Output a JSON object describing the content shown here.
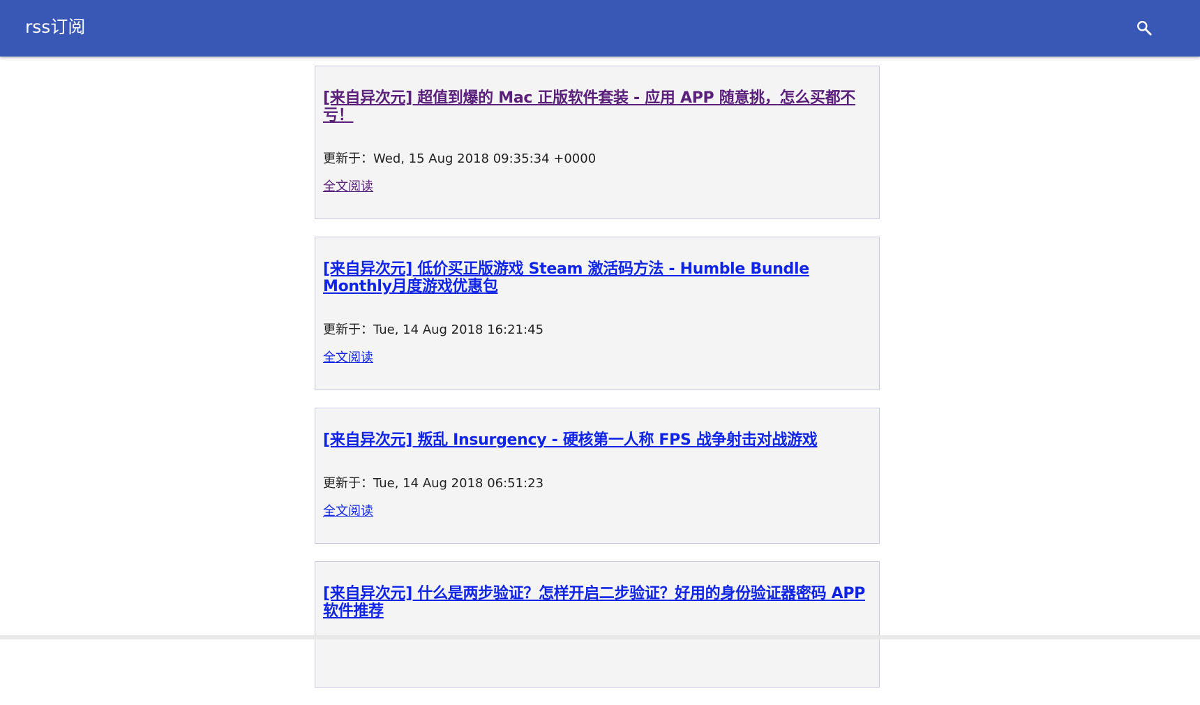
{
  "app": {
    "title": "rss订阅",
    "accent": "#3957b5",
    "search_icon": "search-icon"
  },
  "colors": {
    "visited_link": "#5a1f7a",
    "unvisited_link": "#0f24e6",
    "card_bg": "#f4f4f4",
    "card_border": "#c9cbe4"
  },
  "articles": [
    {
      "title": "[来自异次元] 超值到爆的 Mac 正版软件套装 - 应用 APP 随意挑，怎么买都不亏！",
      "updated_label": "更新于：Wed, 15 Aug 2018 09:35:34 +0000",
      "read_more": "全文阅读",
      "visited": true
    },
    {
      "title": "[来自异次元] 低价买正版游戏 Steam 激活码方法 - Humble Bundle Monthly月度游戏优惠包",
      "updated_label": "更新于：Tue, 14 Aug 2018 16:21:45",
      "read_more": "全文阅读",
      "visited": false
    },
    {
      "title": "[来自异次元] 叛乱 Insurgency - 硬核第一人称 FPS 战争射击对战游戏",
      "updated_label": "更新于：Tue, 14 Aug 2018 06:51:23",
      "read_more": "全文阅读",
      "visited": false
    },
    {
      "title": "[来自异次元] 什么是两步验证？怎样开启二步验证？好用的身份验证器密码 APP 软件推荐",
      "updated_label": "",
      "read_more": "",
      "visited": false
    }
  ]
}
